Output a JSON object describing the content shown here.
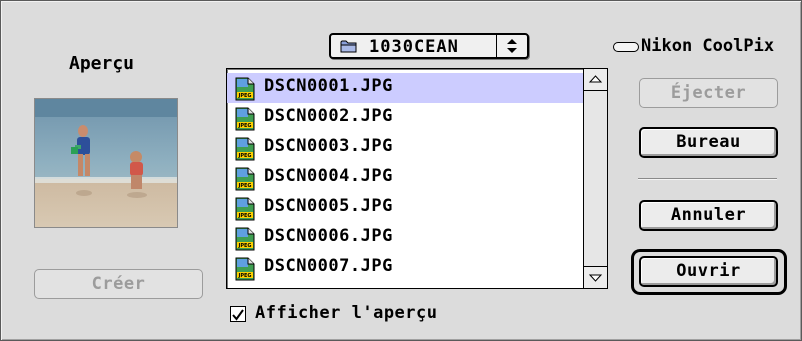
{
  "preview": {
    "title": "Aperçu",
    "image_icon": "beach-photo-thumbnail",
    "create_label": "Créer"
  },
  "volume_popup": {
    "label": "1030CEAN",
    "icon": "folder-icon"
  },
  "file_list": {
    "files": [
      {
        "name": "DSCN0001.JPG",
        "selected": true
      },
      {
        "name": "DSCN0002.JPG",
        "selected": false
      },
      {
        "name": "DSCN0003.JPG",
        "selected": false
      },
      {
        "name": "DSCN0004.JPG",
        "selected": false
      },
      {
        "name": "DSCN0005.JPG",
        "selected": false
      },
      {
        "name": "DSCN0006.JPG",
        "selected": false
      },
      {
        "name": "DSCN0007.JPG",
        "selected": false
      }
    ],
    "icon_badge": "JPEG"
  },
  "show_preview": {
    "label": "Afficher l'aperçu",
    "checked": true
  },
  "sidebar": {
    "volume_name": "Nikon CoolPix",
    "eject_label": "Éjecter",
    "desktop_label": "Bureau",
    "cancel_label": "Annuler",
    "open_label": "Ouvrir"
  },
  "colors": {
    "selection": "#ccccff",
    "background": "#dcdcdc"
  }
}
